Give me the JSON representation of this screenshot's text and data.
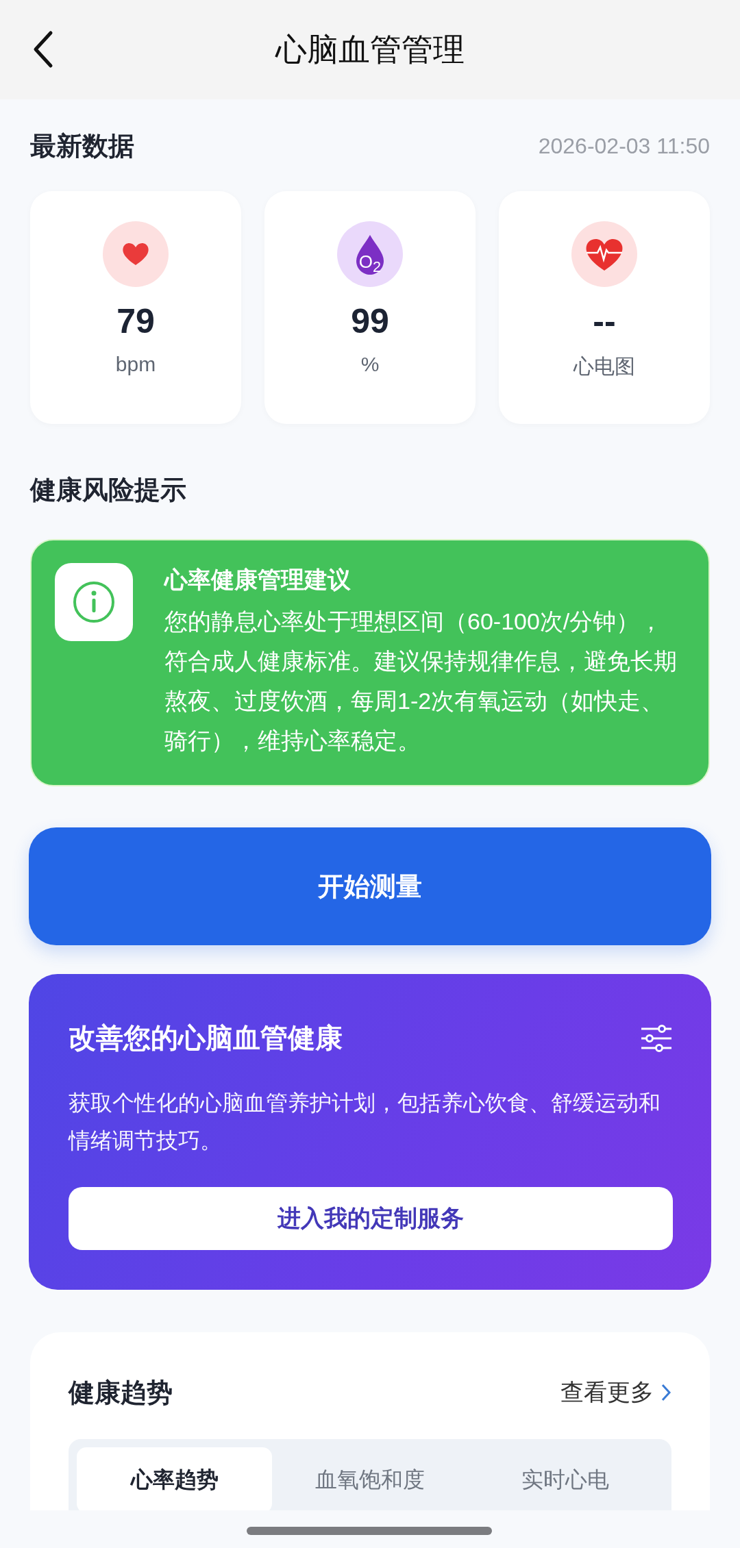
{
  "header": {
    "title": "心脑血管管理"
  },
  "latest": {
    "title": "最新数据",
    "time": "2026-02-03 11:50",
    "metrics": [
      {
        "kind": "heart",
        "value": "79",
        "unit": "bpm"
      },
      {
        "kind": "oxygen",
        "icon_text": "O$_{2}$",
        "value": "99",
        "unit": "%"
      },
      {
        "kind": "ecg",
        "value": "--",
        "unit": "心电图"
      }
    ]
  },
  "risk": {
    "title": "健康风险提示",
    "advice": {
      "title": "心率健康管理建议",
      "text": "您的静息心率处于理想区间（60-100次/分钟），符合成人健康标准。建议保持规律作息，避免长期熬夜、过度饮酒，每周1-2次有氧运动（如快走、骑行），维持心率稳定。"
    }
  },
  "measure_button": "开始测量",
  "promo": {
    "title": "改善您的心脑血管健康",
    "text": "获取个性化的心脑血管养护计划，包括养心饮食、舒缓运动和情绪调节技巧。",
    "button": "进入我的定制服务"
  },
  "trends": {
    "title": "健康趋势",
    "more": "查看更多",
    "tabs": [
      {
        "label": "心率趋势",
        "selected": true
      },
      {
        "label": "血氧饱和度",
        "selected": false
      },
      {
        "label": "实时心电",
        "selected": false
      }
    ]
  }
}
